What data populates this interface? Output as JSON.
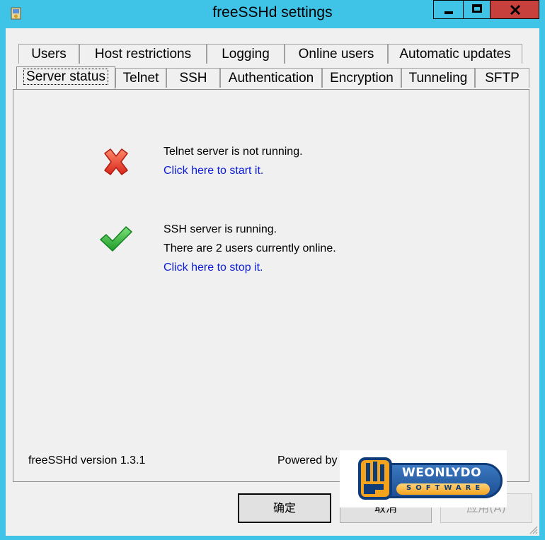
{
  "window": {
    "title": "freeSSHd settings"
  },
  "tabs_back_row": [
    {
      "label": "Users"
    },
    {
      "label": "Host restrictions"
    },
    {
      "label": "Logging"
    },
    {
      "label": "Online users"
    },
    {
      "label": "Automatic updates"
    }
  ],
  "tabs_front_row": [
    {
      "label": "Server status",
      "active": true
    },
    {
      "label": "Telnet"
    },
    {
      "label": "SSH"
    },
    {
      "label": "Authentication"
    },
    {
      "label": "Encryption"
    },
    {
      "label": "Tunneling"
    },
    {
      "label": "SFTP"
    }
  ],
  "telnet": {
    "status_icon": "red-x-icon",
    "status_text": "Telnet server is not running.",
    "action_link": "Click here to start it."
  },
  "ssh": {
    "status_icon": "green-check-icon",
    "status_text": "SSH server is running.",
    "users_text": "There are 2 users currently online.",
    "action_link": "Click here to stop it."
  },
  "footer": {
    "version": "freeSSHd version 1.3.1",
    "powered_by": "Powered by",
    "logo_word": "WEONLYDO",
    "logo_sub": "SOFTWARE"
  },
  "buttons": {
    "ok": "确定",
    "cancel": "取消",
    "apply": "应用(A)"
  },
  "colors": {
    "window_frame": "#3fc3e6",
    "close_button": "#c8403c",
    "link": "#0b1dd6"
  }
}
